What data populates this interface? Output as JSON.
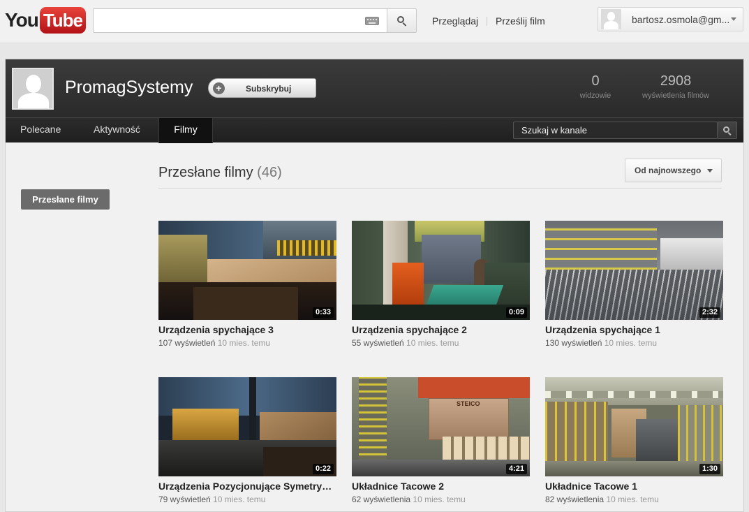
{
  "masthead": {
    "logo": {
      "you": "You",
      "tube": "Tube"
    },
    "search": {
      "placeholder": ""
    },
    "links": {
      "browse": "Przeglądaj",
      "upload": "Prześlij film"
    },
    "user": {
      "email": "bartosz.osmola@gm..."
    }
  },
  "channel": {
    "name": "PromagSystemy",
    "subscribe_label": "Subskrybuj",
    "stats": [
      {
        "value": "0",
        "label": "widzowie"
      },
      {
        "value": "2908",
        "label": "wyświetlenia filmów"
      }
    ],
    "tabs": [
      {
        "label": "Polecane",
        "active": false
      },
      {
        "label": "Aktywność",
        "active": false
      },
      {
        "label": "Filmy",
        "active": true
      }
    ],
    "search_placeholder": "Szukaj w kanale"
  },
  "sidebar": {
    "uploads_button": "Przesłane filmy"
  },
  "section": {
    "title": "Przesłane filmy",
    "count": "(46)",
    "sort_label": "Od najnowszego"
  },
  "videos": [
    {
      "title": "Urządzenia spychające 3",
      "views": "107 wyświetleń",
      "age": "10 mies. temu",
      "duration": "0:33"
    },
    {
      "title": "Urządzenia spychające 2",
      "views": "55 wyświetleń",
      "age": "10 mies. temu",
      "duration": "0:09"
    },
    {
      "title": "Urządzenia spychające 1",
      "views": "130 wyświetleń",
      "age": "10 mies. temu",
      "duration": "2:32"
    },
    {
      "title": "Urządzenia Pozycjonujące Symetryczne",
      "views": "79 wyświetleń",
      "age": "10 mies. temu",
      "duration": "0:22"
    },
    {
      "title": "Układnice Tacowe 2",
      "views": "62 wyświetlenia",
      "age": "10 mies. temu",
      "duration": "4:21"
    },
    {
      "title": "Układnice Tacowe 1",
      "views": "82 wyświetlenia",
      "age": "10 mies. temu",
      "duration": "1:30"
    }
  ],
  "thumbnail_texts": {
    "box_brand": "STEICO"
  },
  "colors": {
    "brand_red": "#cc181e",
    "header_dark": "#2a2a2a",
    "page_bg": "#e7e7e7"
  }
}
